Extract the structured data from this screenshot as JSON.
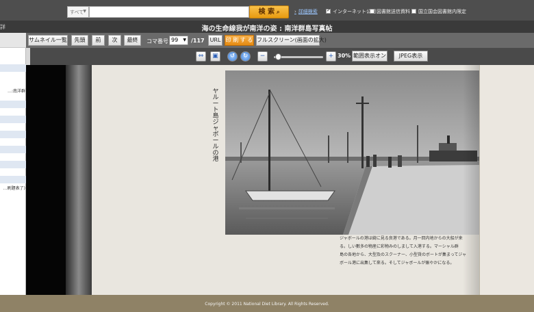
{
  "search": {
    "scope_value": "すべて",
    "query_value": "",
    "button_label": "検 索",
    "advanced_link": "詳細検索",
    "filters": [
      {
        "label": "インターネット公開",
        "checked": true
      },
      {
        "label": "図書館送信資料",
        "checked": false
      },
      {
        "label": "国立国会図書館内限定",
        "checked": false
      }
    ]
  },
  "title_bar": {
    "title": "海の生命線我が南洋の姿 : 南洋群島写真帖",
    "edge_label": "詳"
  },
  "toolbar": {
    "thumbnails_label": "サムネイル一覧",
    "first_label": "先頭",
    "prev_label": "前",
    "next_label": "次",
    "last_label": "最終",
    "frame_label": "コマ番号",
    "frame_value": "99",
    "frame_total": "/117",
    "url_label": "URL",
    "print_label": "印 刷 す る",
    "fullscreen_label": "フルスクリーン(画面の拡大)"
  },
  "sidebar": {
    "snippet_1": "…:南洋群",
    "snippet_2": "…刷題表了)"
  },
  "viewer": {
    "zoom_label": "30%",
    "zoom_level": 0.3,
    "split_view_label": "範囲表示オン",
    "jpeg_label": "JPEG表示"
  },
  "page": {
    "vertical_caption": "ヤルート島ジャボールの港",
    "photo_caption_lines": [
      "ジャボールの港は綺に見る良港である。月一回内地からの大船が来",
      "る。しい數多の物産に彩物みのしまして入港する。マーシャル群",
      "島の各地から、大型及のスクーナー、小型貨のボートが集まってジャ",
      "ボール港に出集して來る。そしてジャボールが賑やかになる。"
    ]
  },
  "footer": {
    "copyright": "Copyright © 2011 National Diet Library. All Rights Reserved."
  },
  "colors": {
    "topbar": "#4e4e4e",
    "search_button": "#f0a820",
    "print_button": "#ec9420",
    "footer": "#8f8266"
  },
  "icons": [
    "magnifier-icon",
    "fit-width-icon",
    "fit-page-icon",
    "rotate-left-icon",
    "rotate-right-icon",
    "zoom-out-icon",
    "zoom-in-icon",
    "dropdown-caret-icon"
  ]
}
